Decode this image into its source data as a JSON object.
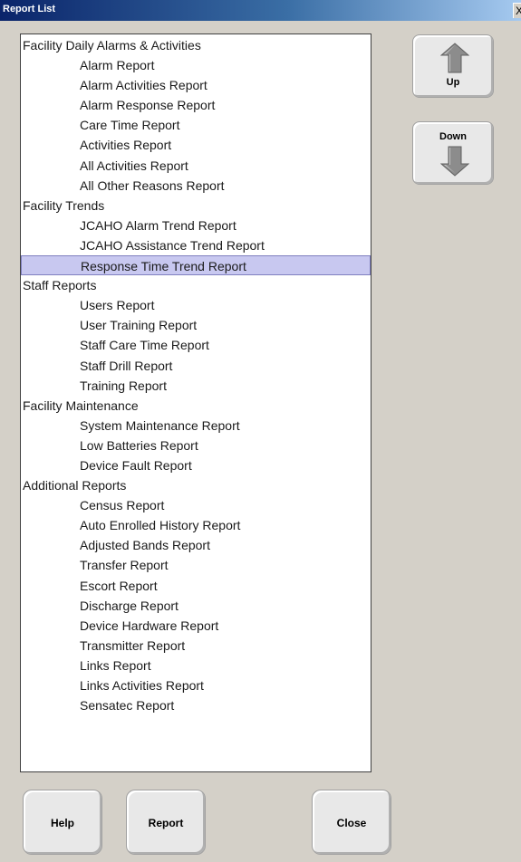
{
  "window": {
    "title": "Report List",
    "close_glyph": "X"
  },
  "report_list": {
    "items": [
      {
        "label": "Facility Daily Alarms & Activities",
        "level": "category"
      },
      {
        "label": "Alarm Report",
        "level": "child"
      },
      {
        "label": "Alarm Activities Report",
        "level": "child"
      },
      {
        "label": "Alarm Response Report",
        "level": "child"
      },
      {
        "label": "Care Time Report",
        "level": "child"
      },
      {
        "label": "Activities Report",
        "level": "child"
      },
      {
        "label": "All Activities Report",
        "level": "child"
      },
      {
        "label": "All Other Reasons Report",
        "level": "child"
      },
      {
        "label": "Facility Trends",
        "level": "category"
      },
      {
        "label": "JCAHO Alarm Trend Report",
        "level": "child"
      },
      {
        "label": "JCAHO Assistance Trend Report",
        "level": "child"
      },
      {
        "label": "Response Time Trend Report",
        "level": "child",
        "selected": true
      },
      {
        "label": "Staff Reports",
        "level": "category"
      },
      {
        "label": "Users Report",
        "level": "child"
      },
      {
        "label": "User Training Report",
        "level": "child"
      },
      {
        "label": "Staff Care Time Report",
        "level": "child"
      },
      {
        "label": "Staff Drill Report",
        "level": "child"
      },
      {
        "label": "Training Report",
        "level": "child"
      },
      {
        "label": "Facility Maintenance",
        "level": "category"
      },
      {
        "label": "System Maintenance Report",
        "level": "child"
      },
      {
        "label": "Low Batteries Report",
        "level": "child"
      },
      {
        "label": "Device Fault Report",
        "level": "child"
      },
      {
        "label": "Additional Reports",
        "level": "category"
      },
      {
        "label": "Census Report",
        "level": "child"
      },
      {
        "label": "Auto Enrolled History Report",
        "level": "child"
      },
      {
        "label": "Adjusted Bands Report",
        "level": "child"
      },
      {
        "label": "Transfer Report",
        "level": "child"
      },
      {
        "label": "Escort Report",
        "level": "child"
      },
      {
        "label": "Discharge Report",
        "level": "child"
      },
      {
        "label": "Device Hardware Report",
        "level": "child"
      },
      {
        "label": "Transmitter Report",
        "level": "child"
      },
      {
        "label": "Links Report",
        "level": "child"
      },
      {
        "label": "Links Activities Report",
        "level": "child"
      },
      {
        "label": "Sensatec Report",
        "level": "child"
      }
    ]
  },
  "side_buttons": {
    "up_label": "Up",
    "up_icon": "arrow-up-icon",
    "down_label": "Down",
    "down_icon": "arrow-down-icon"
  },
  "bottom_buttons": {
    "help_label": "Help",
    "report_label": "Report",
    "close_label": "Close"
  },
  "colors": {
    "title_bar": "#0a246a",
    "window_bg": "#d4d0c8",
    "selection_bg": "#c8c8f0",
    "arrow_fill": "#8c8c8c"
  }
}
